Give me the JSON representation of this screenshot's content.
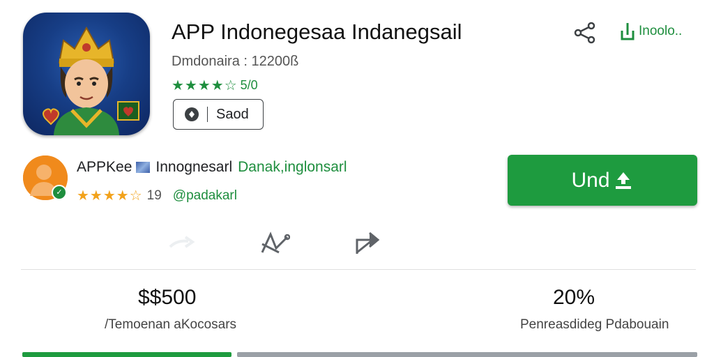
{
  "app": {
    "title": "APP Indonegesaa Indanegsail",
    "developer": "Dmdonaira : 12200ß",
    "stars": "★★★★☆",
    "rating": "5/0",
    "saved_label": "Saod"
  },
  "top_actions": {
    "install_label": "Inoolo.."
  },
  "developer_row": {
    "prefix": "APPKee",
    "name": "Innognesarl",
    "tagline": "Danak,inglonsarl",
    "stars": "★★★★☆",
    "count": "19",
    "handle": "@padakarl"
  },
  "install_button": {
    "label": "Und"
  },
  "stats": [
    {
      "value": "$$500",
      "label": "/Temoenan aKocosars"
    },
    {
      "value": "20%",
      "label": "Penreasdideg Pdabouain"
    }
  ],
  "progress": {
    "fraction": 0.31
  },
  "colors": {
    "accent": "#1e9b3f",
    "star_orange": "#f2a21b",
    "icon_blue": "#173e86"
  }
}
